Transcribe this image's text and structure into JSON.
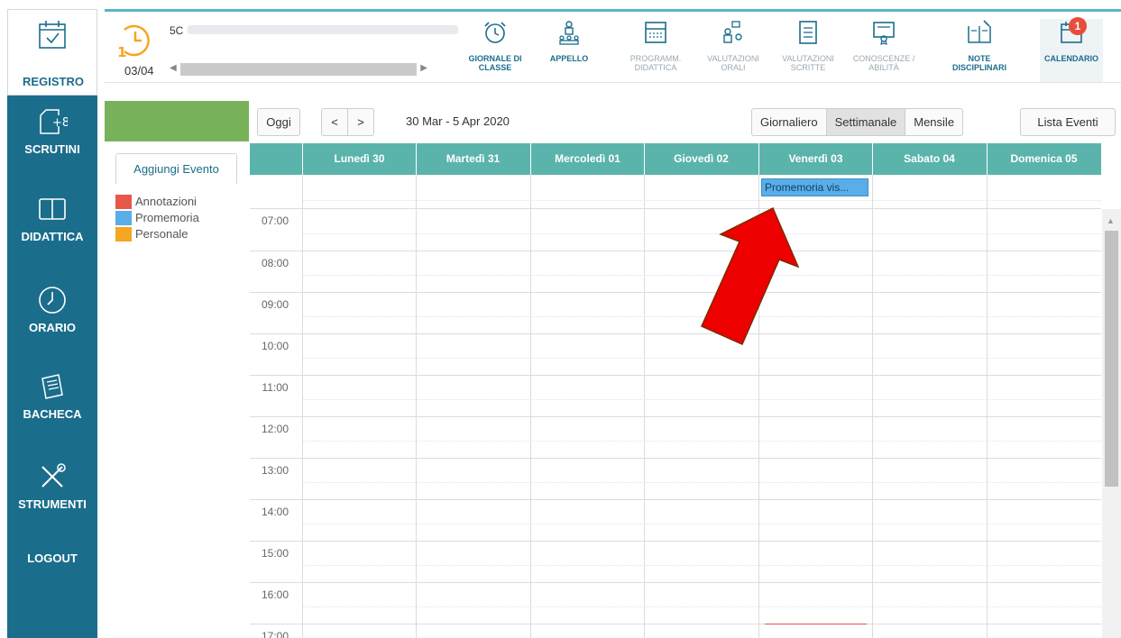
{
  "sidebar": {
    "registro": "REGISTRO",
    "scrutini": "SCRUTINI",
    "didattica": "DIDATTICA",
    "orario": "ORARIO",
    "bacheca": "BACHECA",
    "strumenti": "STRUMENTI",
    "logout": "LOGOUT"
  },
  "header": {
    "class_code": "5C",
    "date": "03/04",
    "calendar_badge": "1"
  },
  "toolbar": {
    "giornale": "GIORNALE DI CLASSE",
    "appello": "APPELLO",
    "programm": "PROGRAMM. DIDATTICA",
    "val_orali": "VALUTAZIONI ORALI",
    "val_scritte": "VALUTAZIONI SCRITTE",
    "conoscenze": "CONOSCENZE / ABILITÀ",
    "note": "NOTE DISCIPLINARI",
    "calendario": "CALENDARIO"
  },
  "left_panel": {
    "add_event": "Aggiungi Evento",
    "legend": [
      {
        "label": "Annotazioni",
        "color": "#e8584a"
      },
      {
        "label": "Promemoria",
        "color": "#5aaee8"
      },
      {
        "label": "Personale",
        "color": "#f5a623"
      }
    ]
  },
  "controls": {
    "today": "Oggi",
    "prev": "<",
    "next": ">",
    "range": "30 Mar - 5 Apr 2020",
    "views": [
      "Giornaliero",
      "Settimanale",
      "Mensile"
    ],
    "selected_view": "Settimanale",
    "list_events": "Lista Eventi"
  },
  "calendar": {
    "days": [
      "Lunedì 30",
      "Martedì 31",
      "Mercoledì 01",
      "Giovedì 02",
      "Venerdì 03",
      "Sabato 04",
      "Domenica 05"
    ],
    "hours": [
      "07:00",
      "08:00",
      "09:00",
      "10:00",
      "11:00",
      "12:00",
      "13:00",
      "14:00",
      "15:00",
      "16:00",
      "17:00"
    ],
    "event": "Promemoria vis..."
  },
  "colors": {
    "sidebar": "#1b6d8c",
    "header_row": "#5ab4ab",
    "green_bar": "#77b25b",
    "arrow": "#ee0000"
  }
}
